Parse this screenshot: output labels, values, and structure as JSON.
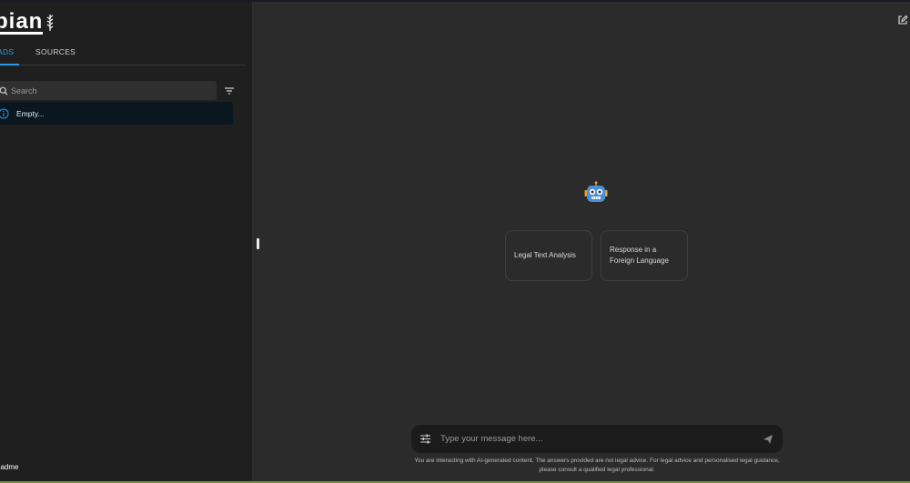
{
  "logo": {
    "text": "pian"
  },
  "sidebar": {
    "tabs": [
      {
        "label": "EADS",
        "active": true
      },
      {
        "label": "SOURCES",
        "active": false
      }
    ],
    "search": {
      "placeholder": "Search",
      "value": ""
    },
    "empty_message": "Empty...",
    "readme_label": "eadme"
  },
  "main": {
    "starters": [
      {
        "label": "Legal Text Analysis"
      },
      {
        "label": "Response in a Foreign Language"
      }
    ],
    "composer": {
      "placeholder": "Type your message here...",
      "value": ""
    },
    "disclaimer": "You are interacting with AI-generated content. The answers provided are not legal advice. For legal advice and personalised legal guidance, please consult a qualified legal professional."
  },
  "colors": {
    "accent": "#2b9be8",
    "sidebar_bg": "#1f1f1f",
    "main_bg": "#2b2b2b",
    "alert_bg": "#0b171e",
    "composer_bg": "#1b1b1b"
  },
  "icons": [
    "search-icon",
    "filter-icon",
    "info-icon",
    "bot-icon",
    "settings-icon",
    "send-icon",
    "new-chat-icon"
  ]
}
